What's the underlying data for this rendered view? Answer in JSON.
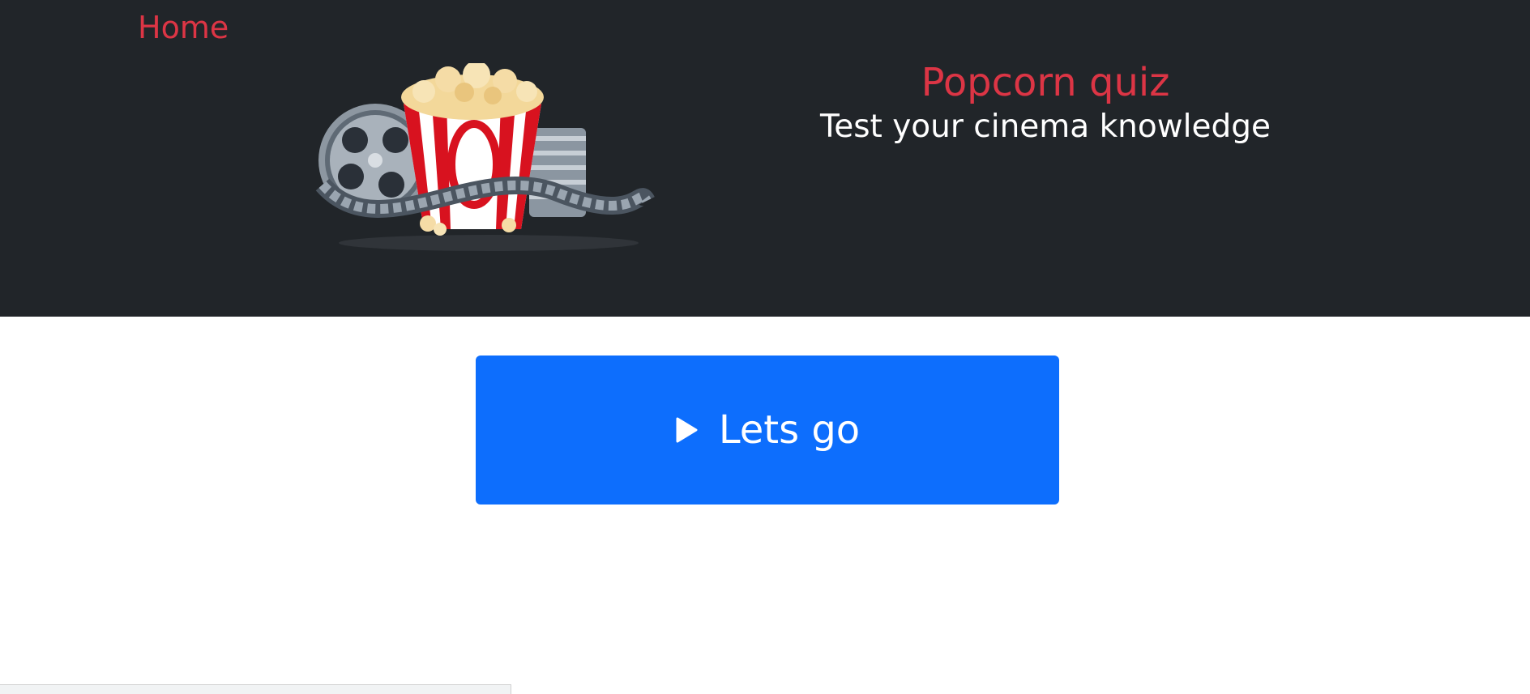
{
  "nav": {
    "home_label": "Home"
  },
  "hero": {
    "image_description": "popcorn-and-film-reel"
  },
  "header": {
    "title": "Popcorn quiz",
    "subtitle": "Test your cinema knowledge"
  },
  "main": {
    "start_button_label": "Lets go",
    "start_button_icon": "play-icon"
  },
  "status_bar": {
    "text": ""
  },
  "colors": {
    "header_bg": "#212529",
    "accent_red": "#dc3545",
    "primary_blue": "#0d6efd"
  }
}
